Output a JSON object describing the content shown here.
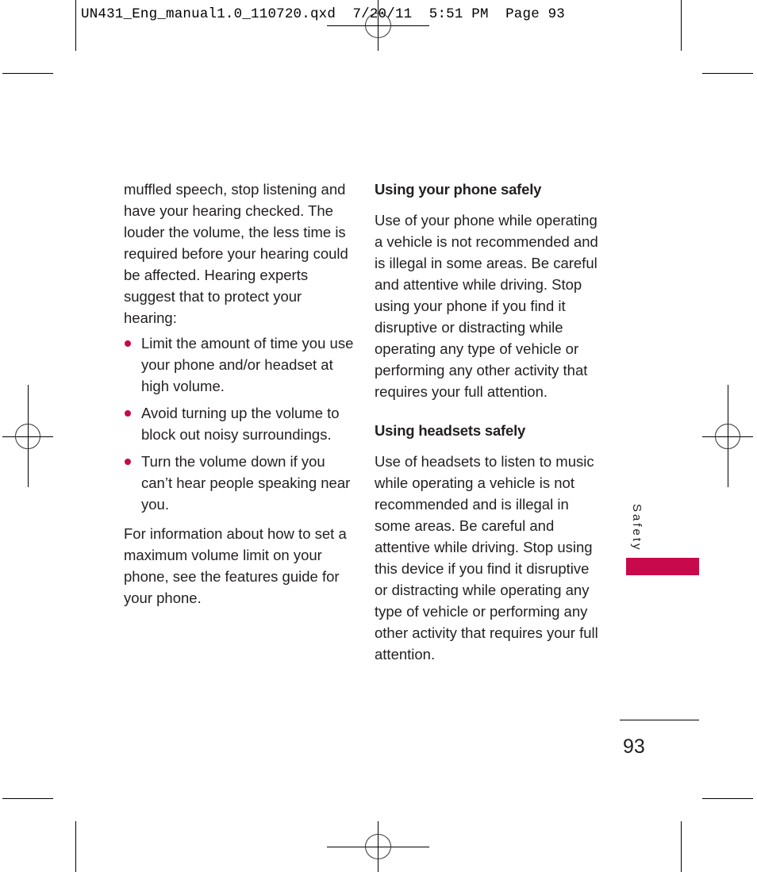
{
  "slug_line": "UN431_Eng_manual1.0_110720.qxd  7/20/11  5:51 PM  Page 93",
  "colors": {
    "accent": "#c8094b",
    "text": "#231f20"
  },
  "left_column": {
    "intro": "muffled speech, stop listening and have your hearing checked. The louder the volume, the less time is required before your hearing could be affected. Hearing experts suggest that to protect your hearing:",
    "bullets": [
      "Limit the amount of time you use your phone and/or headset at high volume.",
      "Avoid turning up the volume to block out noisy surroundings.",
      "Turn the volume down if you can’t hear people speaking near you."
    ],
    "closing": "For information about how to set a maximum volume limit on your phone, see the features guide for your phone."
  },
  "right_column": {
    "sections": [
      {
        "heading": "Using your phone safely",
        "body": "Use of your phone while operating a vehicle is not recommended and is illegal in some areas. Be careful and attentive while driving. Stop using your phone if you find it disruptive or distracting while operating any type of vehicle or performing any other activity that requires your full attention."
      },
      {
        "heading": "Using headsets safely",
        "body": "Use of headsets to listen to music while operating a vehicle is not recommended and is illegal in some areas. Be careful and attentive while driving. Stop using this device if you find it disruptive or distracting while operating any type of vehicle or performing any other activity that requires your full attention."
      }
    ]
  },
  "side_tab": {
    "label": "Safety"
  },
  "page_number": "93",
  "icons": {
    "bullet": "bullet-dot-icon",
    "registration": "registration-mark-icon",
    "crop": "crop-mark-icon"
  }
}
